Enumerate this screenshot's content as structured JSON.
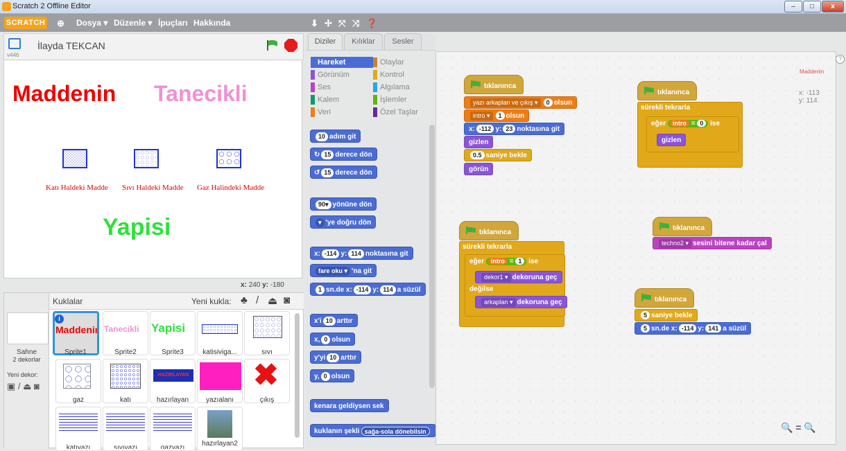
{
  "window": {
    "title": "Scratch 2 Offline Editor",
    "minimize": "–",
    "maximize": "□",
    "close": "x"
  },
  "menu": {
    "logo": "SCRATCH",
    "file": "Dosya ▾",
    "edit": "Düzenle ▾",
    "tips": "İpuçları",
    "about": "Hakkında"
  },
  "stage": {
    "version": "v446",
    "project_name": "İlayda TEKCAN",
    "title_left": "Maddenin",
    "title_right": "Tanecikli",
    "bottom": "Yapisi",
    "labels": [
      "Katı Haldeki Madde",
      "Sıvı Haldeki Madde",
      "Gaz Halindeki Madde"
    ],
    "coords_x_label": "x:",
    "coords_x": "240",
    "coords_y_label": "y:",
    "coords_y": "-180"
  },
  "sprites_panel": {
    "header": "Kuklalar",
    "new_sprite": "Yeni kukla:",
    "stage_label": "Sahne",
    "stage_backdrops": "2 dekorlar",
    "new_backdrop": "Yeni dekor:",
    "sprites": [
      {
        "name": "Sprite1",
        "preview": "Maddenin"
      },
      {
        "name": "Sprite2",
        "preview": "Tanecikli"
      },
      {
        "name": "Sprite3",
        "preview": "Yapisi"
      },
      {
        "name": "katisiviga...",
        "preview": ""
      },
      {
        "name": "sıvı",
        "preview": ""
      },
      {
        "name": "gaz",
        "preview": ""
      },
      {
        "name": "katı",
        "preview": ""
      },
      {
        "name": "hazırlayan",
        "preview": "HAZIRLAYAN"
      },
      {
        "name": "yazıalanı",
        "preview": ""
      },
      {
        "name": "çıkış",
        "preview": ""
      },
      {
        "name": "katıyazı",
        "preview": ""
      },
      {
        "name": "sıvıyazı",
        "preview": ""
      },
      {
        "name": "gazyazı",
        "preview": ""
      },
      {
        "name": "hazırlayan2",
        "preview": ""
      }
    ]
  },
  "tabs": {
    "scripts": "Diziler",
    "costumes": "Kılıklar",
    "sounds": "Sesler"
  },
  "categories": {
    "left": [
      "Hareket",
      "Görünüm",
      "Ses",
      "Kalem",
      "Veri"
    ],
    "right": [
      "Olaylar",
      "Kontrol",
      "Algılama",
      "İşlemler",
      "Özel Taşlar"
    ],
    "colors": {
      "Hareket": "#4a6cd4",
      "Görünüm": "#8a55d7",
      "Ses": "#bb42c3",
      "Kalem": "#0e9a6c",
      "Veri": "#ee7d16",
      "Olaylar": "#c88330",
      "Kontrol": "#e1a91a",
      "Algılama": "#2ca5e2",
      "İşlemler": "#5cb712",
      "Özel Taşlar": "#632d99"
    }
  },
  "palette": {
    "move": {
      "v": "10",
      "t": "adım git"
    },
    "turn_r": {
      "v": "15",
      "t": "derece dön"
    },
    "turn_l": {
      "v": "15",
      "t": "derece dön"
    },
    "point_dir": {
      "v": "90▾",
      "t": "yönüne dön"
    },
    "point_to": {
      "v": "▾",
      "t": "'ye doğru dön"
    },
    "goto_xy": {
      "a": "x:",
      "x": "-114",
      "b": "y:",
      "y": "114",
      "t": "noktasına git"
    },
    "goto": {
      "v": "fare oku ▾",
      "t": "'na git"
    },
    "glide": {
      "s": "1",
      "a": "sn.de x:",
      "x": "-114",
      "b": "y:",
      "y": "114",
      "t": "a süzül"
    },
    "change_x": {
      "a": "x'i",
      "v": "10",
      "t": "arttır"
    },
    "set_x": {
      "a": "x,",
      "v": "0",
      "t": "olsun"
    },
    "change_y": {
      "a": "y'yi",
      "v": "10",
      "t": "arttır"
    },
    "set_y": {
      "a": "y,",
      "v": "0",
      "t": "olsun"
    },
    "bounce": "kenara geldiysen sek",
    "rotation": {
      "a": "kuklanın şekli",
      "v": "sağa-sola dönebilsin"
    }
  },
  "script_area": {
    "sprite_name": "Maddenin",
    "x_label": "x:",
    "x": "-113",
    "y_label": "y:",
    "y": "114",
    "hat": "tıklanınca",
    "s1": {
      "l1": {
        "a": "yazı arkaplan ve çıkış ▾",
        "v": "0",
        "t": "olsun"
      },
      "l2": {
        "a": "intro ▾",
        "v": "1",
        "t": "olsun"
      },
      "l3": {
        "a": "x:",
        "x": "-112",
        "b": "y:",
        "y": "23",
        "t": "noktasına git"
      },
      "l4": "gizlen",
      "l5": {
        "v": "0.5",
        "t": "saniye bekle"
      },
      "l6": "görün"
    },
    "s2": {
      "forever": "sürekli tekrarla",
      "if": "eğer",
      "var": "intro",
      "eq": "=",
      "v": "0",
      "then": "ise",
      "hide": "gizlen"
    },
    "s3": {
      "forever": "sürekli tekrarla",
      "if": "eğer",
      "var": "intro",
      "eq": "=",
      "v": "1",
      "then": "ise",
      "sw1": "dekor1 ▾",
      "sw_t": "dekoruna geç",
      "else": "değilse",
      "sw2": "arkaplan ▾"
    },
    "s4": {
      "a": "techno2 ▾",
      "t": "sesini bitene kadar çal"
    },
    "s5": {
      "wait_v": "5",
      "wait_t": "saniye bekle",
      "g_s": "5",
      "g_a": "sn.de x:",
      "g_x": "-114",
      "g_b": "y:",
      "g_y": "141",
      "g_t": "a süzül"
    },
    "zoom": "🔍 = 🔍"
  }
}
